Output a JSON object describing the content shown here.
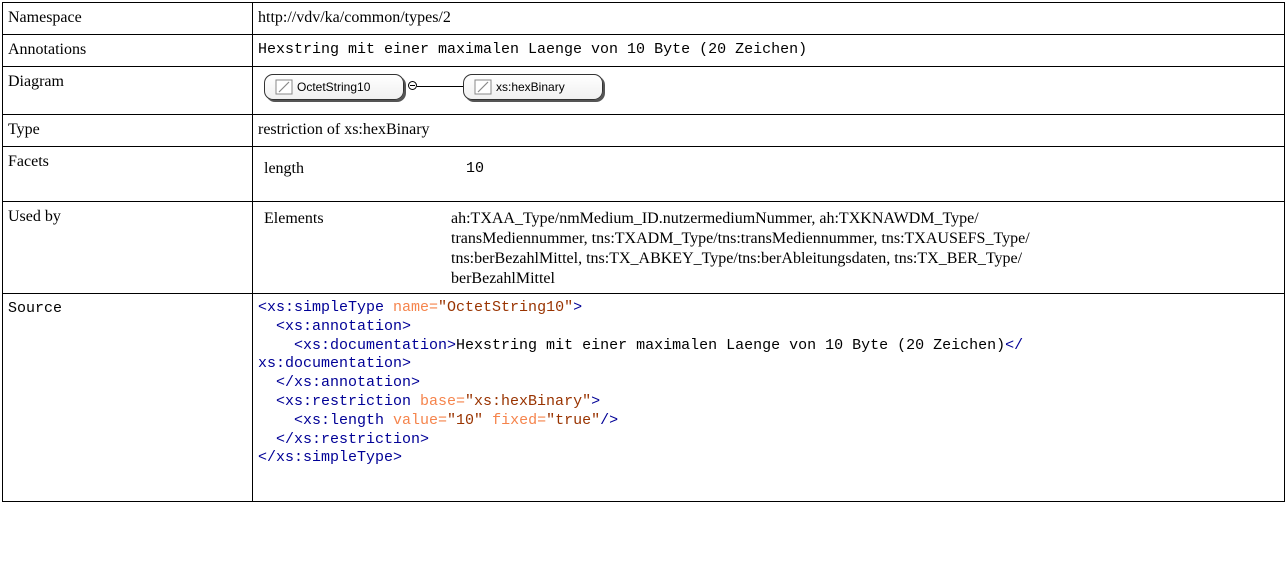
{
  "rows": {
    "namespace": {
      "label": "Namespace",
      "value": "http://vdv/ka/common/types/2"
    },
    "annotations": {
      "label": "Annotations",
      "value": "Hexstring mit einer maximalen Laenge von 10 Byte (20 Zeichen)"
    },
    "diagram": {
      "label": "Diagram",
      "node1": "OctetString10",
      "node2": "xs:hexBinary"
    },
    "type": {
      "label": "Type",
      "value": "restriction of xs:hexBinary"
    },
    "facets": {
      "label": "Facets",
      "name": "length",
      "value": "10"
    },
    "used_by": {
      "label": "Used by",
      "name": "Elements",
      "line1": "ah:TXAA_Type/nmMedium_ID.nutzermediumNummer, ah:TXKNAWDM_Type/",
      "line2": "transMediennummer, tns:TXADM_Type/tns:transMediennummer, tns:TXAUSEFS_Type/",
      "line3": "tns:berBezahlMittel, tns:TX_ABKEY_Type/tns:berAbleitungsdaten, tns:TX_BER_Type/",
      "line4": "berBezahlMittel"
    },
    "source": {
      "label": "Source",
      "l1_tag_open": "<xs:simpleType",
      "l1_attr": " name=",
      "l1_val": "\"OctetString10\"",
      "l1_close": ">",
      "l2_tag": "  <xs:annotation>",
      "l3_tag": "    <xs:documentation>",
      "l3_text": "Hexstring mit einer maximalen Laenge von 10 Byte (20 Zeichen)",
      "l3_close": "</",
      "l4_tag": "xs:documentation>",
      "l5_tag": "  </xs:annotation>",
      "l6_tag_open": "  <xs:restriction",
      "l6_attr": " base=",
      "l6_val": "\"xs:hexBinary\"",
      "l6_close": ">",
      "l7_tag_open": "    <xs:length",
      "l7_attr1": " value=",
      "l7_val1": "\"10\"",
      "l7_attr2": " fixed=",
      "l7_val2": "\"true\"",
      "l7_close": "/>",
      "l8_tag": "  </xs:restriction>",
      "l9_tag": "</xs:simpleType>"
    }
  }
}
